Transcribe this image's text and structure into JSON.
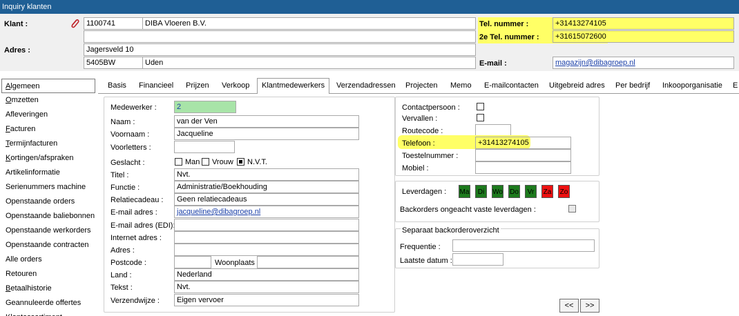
{
  "window": {
    "title": "Inquiry klanten"
  },
  "header": {
    "klant_label": "Klant :",
    "klant_nr": "1100741",
    "klant_naam": "DIBA Vloeren B.V.",
    "adres_label": "Adres :",
    "straat": "Jagersveld 10",
    "postcode": "5405BW",
    "plaats": "Uden",
    "tel_label": "Tel. nummer :",
    "tel_value": "+31413274105",
    "tel2_label": "2e Tel. nummer :",
    "tel2_value": "+31615072600",
    "email_label": "E-mail :",
    "email_value": "magazijn@dibagroep.nl"
  },
  "sidebar": {
    "items": [
      "Algemeen",
      "Omzetten",
      "Afleveringen",
      "Facturen",
      "Termijnfacturen",
      "Kortingen/afspraken",
      "Artikelinformatie",
      "Serienummers machine",
      "Openstaande orders",
      "Openstaande baliebonnen",
      "Openstaande werkorders",
      "Openstaande contracten",
      "Alle orders",
      "Retouren",
      "Betaalhistorie",
      "Geannuleerde offertes",
      "Klantassortiment"
    ]
  },
  "tabs": [
    "Basis",
    "Financieel",
    "Prijzen",
    "Verkoop",
    "Klantmedewerkers",
    "Verzendadressen",
    "Projecten",
    "Memo",
    "E-mailcontacten",
    "Uitgebreid adres",
    "Per bedrijf",
    "Inkooporganisatie",
    "E"
  ],
  "employee": {
    "medewerker_label": "Medewerker :",
    "medewerker_value": "2",
    "naam_label": "Naam :",
    "naam_value": "van der Ven",
    "voornaam_label": "Voornaam :",
    "voornaam_value": "Jacqueline",
    "voorletters_label": "Voorletters :",
    "voorletters_value": "",
    "geslacht_label": "Geslacht :",
    "geslacht_options": [
      "Man",
      "Vrouw",
      "N.V.T."
    ],
    "titel_label": "Titel :",
    "titel_value": "Nvt.",
    "functie_label": "Functie :",
    "functie_value": "Administratie/Boekhouding",
    "relatiecadeau_label": "Relatiecadeau :",
    "relatiecadeau_value": "Geen relatiecadeaus",
    "email_label": "E-mail adres :",
    "email_value": "jacqueline@dibagroep.nl",
    "email_edi_label": "E-mail adres  (EDI):",
    "email_edi_value": "",
    "internet_label": "Internet adres :",
    "internet_value": "",
    "adres_label": "Adres :",
    "adres_value": "",
    "postcode_label": "Postcode :",
    "postcode_value": "",
    "woonplaats_label": "Woonplaats :",
    "woonplaats_value": "",
    "land_label": "Land :",
    "land_value": "Nederland",
    "tekst_label": "Tekst :",
    "tekst_value": "Nvt.",
    "verzendwijze_label": "Verzendwijze :",
    "verzendwijze_value": "Eigen vervoer"
  },
  "contact": {
    "contactpersoon_label": "Contactpersoon :",
    "vervallen_label": "Vervallen :",
    "routecode_label": "Routecode :",
    "routecode_value": "",
    "telefoon_label": "Telefoon :",
    "telefoon_value": "+31413274105",
    "toestelnummer_label": "Toestelnummer :",
    "toestelnummer_value": "",
    "mobiel_label": "Mobiel :",
    "mobiel_value": ""
  },
  "delivery": {
    "leverdagen_label": "Leverdagen :",
    "days": [
      "Ma",
      "Di",
      "Wo",
      "Do",
      "Vr",
      "Za",
      "Zo"
    ],
    "colors": {
      "on": "#1d7a1d",
      "off": "#ee1111"
    },
    "backorders_label": "Backorders ongeacht vaste leverdagen :"
  },
  "backorder": {
    "title": "Separaat backorderoverzicht",
    "frequentie_label": "Frequentie :",
    "frequentie_value": "",
    "laatste_label": "Laatste datum :",
    "laatste_value": ""
  },
  "nav": {
    "prev": "<<",
    "next": ">>"
  }
}
